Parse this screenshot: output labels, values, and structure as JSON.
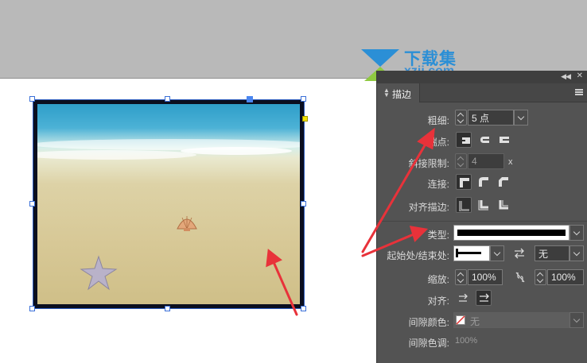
{
  "watermark": {
    "title": "下载集",
    "subtitle": "xzji.com",
    "brand_color": "#2b8fd6"
  },
  "panel": {
    "tab_label": "描边",
    "rows": {
      "weight": {
        "label": "粗细:",
        "value": "5 点"
      },
      "cap": {
        "label": "端点:"
      },
      "miter": {
        "label": "斜接限制:",
        "value": "4",
        "unit": "x"
      },
      "join": {
        "label": "连接:"
      },
      "align": {
        "label": "对齐描边:"
      },
      "type": {
        "label": "类型:"
      },
      "ends": {
        "label": "起始处/结束处:",
        "end_value": "无"
      },
      "scale": {
        "label": "缩放:",
        "start_value": "100%",
        "end_value": "100%"
      },
      "arrow_align": {
        "label": "对齐:"
      },
      "gap_color": {
        "label": "间隙颜色:",
        "value": "无"
      },
      "gap_tint": {
        "label": "间隙色调:",
        "value": "100%"
      }
    }
  },
  "colors": {
    "panel_bg": "#535353",
    "pasteboard": "#b9b9b9",
    "selection": "#3a6fd8",
    "annotation_arrow": "#e8323a"
  },
  "icons": [
    "collapse-icon",
    "close-icon",
    "panel-menu-icon",
    "spinner-icon",
    "dropdown-icon",
    "butt-cap-icon",
    "round-cap-icon",
    "projecting-cap-icon",
    "miter-join-icon",
    "round-join-icon",
    "bevel-join-icon",
    "align-center-icon",
    "align-inside-icon",
    "align-outside-icon",
    "swap-icon",
    "link-icon"
  ]
}
